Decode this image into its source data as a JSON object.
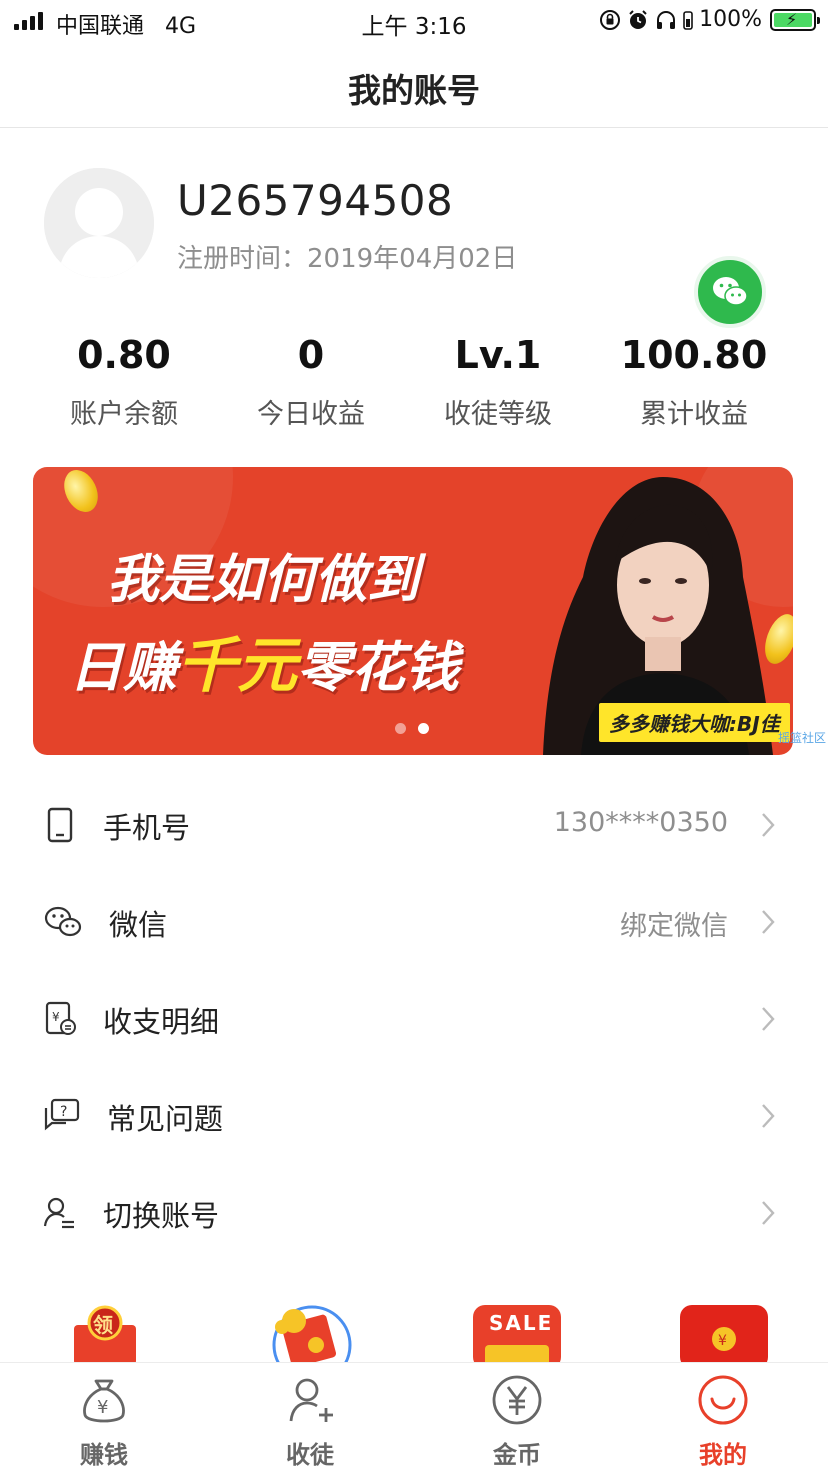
{
  "status_bar": {
    "carrier": "中国联通",
    "network": "4G",
    "time": "上午 3:16",
    "battery_percent": "100%"
  },
  "nav": {
    "title": "我的账号"
  },
  "profile": {
    "username": "U265794508",
    "registered_label": "注册时间：",
    "registered_date": "2019年04月02日"
  },
  "stats": [
    {
      "value": "0.80",
      "label": "账户余额"
    },
    {
      "value": "0",
      "label": "今日收益"
    },
    {
      "value": "Lv.1",
      "label": "收徒等级"
    },
    {
      "value": "100.80",
      "label": "累计收益"
    }
  ],
  "banner": {
    "line1": "我是如何做到",
    "line2_prefix": "日赚",
    "line2_highlight": "千元",
    "line2_suffix": "零花钱",
    "tag": "多多赚钱大咖:BJ佳",
    "active_dot": 2,
    "watermark": "摇篮社区"
  },
  "menu": [
    {
      "icon": "phone-icon",
      "label": "手机号",
      "value": "130****0350"
    },
    {
      "icon": "wechat-icon",
      "label": "微信",
      "value": "绑定微信"
    },
    {
      "icon": "bill-icon",
      "label": "收支明细",
      "value": ""
    },
    {
      "icon": "help-icon",
      "label": "常见问题",
      "value": ""
    },
    {
      "icon": "switch-account-icon",
      "label": "切换账号",
      "value": ""
    }
  ],
  "promos": {
    "claim_label": "领",
    "sale_label": "SALE"
  },
  "tabbar": [
    {
      "label": "赚钱",
      "icon": "money-bag-icon",
      "active": false
    },
    {
      "label": "收徒",
      "icon": "add-user-icon",
      "active": false
    },
    {
      "label": "金币",
      "icon": "coin-icon",
      "active": false
    },
    {
      "label": "我的",
      "icon": "smile-icon",
      "active": true
    }
  ],
  "colors": {
    "accent": "#e8402a",
    "banner_bg": "#e4432a",
    "highlight_yellow": "#ffe52a",
    "wechat_green": "#2fb94d"
  }
}
